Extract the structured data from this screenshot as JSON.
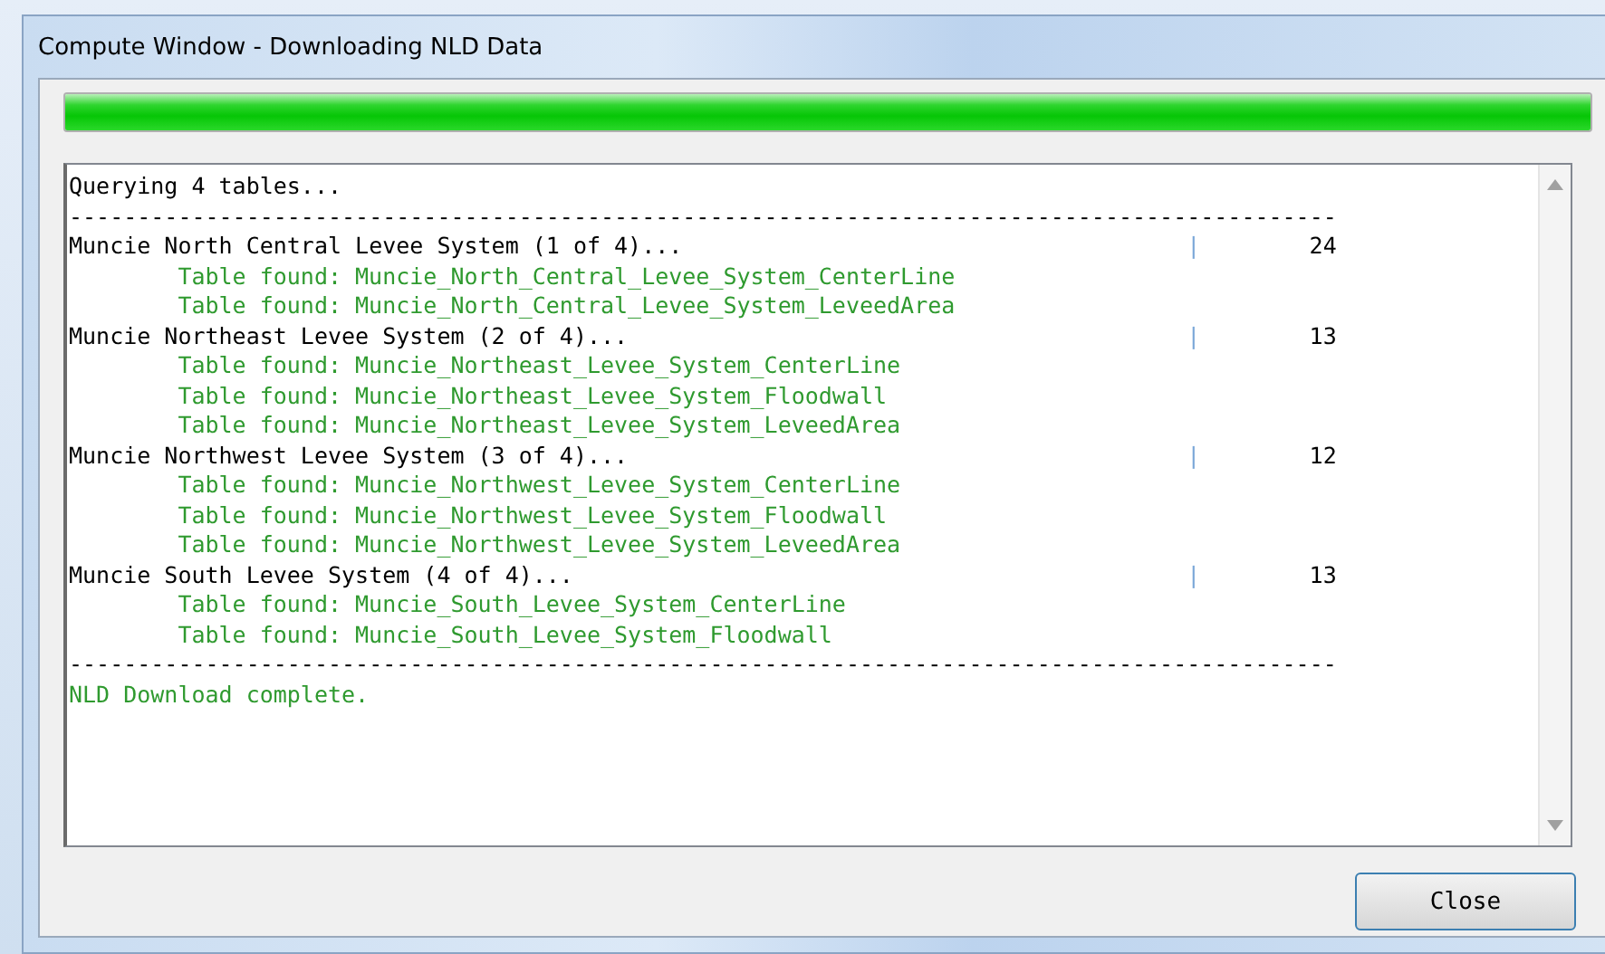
{
  "window": {
    "title": "Compute Window - Downloading NLD Data"
  },
  "progress": {
    "level": 1
  },
  "log": [
    {
      "kind": "text",
      "text": "Querying 4 tables..."
    },
    {
      "kind": "rule",
      "text": "---------------------------------------------------------------------------------------------"
    },
    {
      "kind": "system",
      "text": "Muncie North Central Levee System (1 of 4)...",
      "bar": "|",
      "count": "24"
    },
    {
      "kind": "found",
      "text": "Table found: Muncie_North_Central_Levee_System_CenterLine"
    },
    {
      "kind": "found",
      "text": "Table found: Muncie_North_Central_Levee_System_LeveedArea"
    },
    {
      "kind": "system",
      "text": "Muncie Northeast Levee System (2 of 4)...",
      "bar": "|",
      "count": "13"
    },
    {
      "kind": "found",
      "text": "Table found: Muncie_Northeast_Levee_System_CenterLine"
    },
    {
      "kind": "found",
      "text": "Table found: Muncie_Northeast_Levee_System_Floodwall"
    },
    {
      "kind": "found",
      "text": "Table found: Muncie_Northeast_Levee_System_LeveedArea"
    },
    {
      "kind": "system",
      "text": "Muncie Northwest Levee System (3 of 4)...",
      "bar": "|",
      "count": "12"
    },
    {
      "kind": "found",
      "text": "Table found: Muncie_Northwest_Levee_System_CenterLine"
    },
    {
      "kind": "found",
      "text": "Table found: Muncie_Northwest_Levee_System_Floodwall"
    },
    {
      "kind": "found",
      "text": "Table found: Muncie_Northwest_Levee_System_LeveedArea"
    },
    {
      "kind": "system",
      "text": "Muncie South Levee System (4 of 4)...",
      "bar": "|",
      "count": "13"
    },
    {
      "kind": "found",
      "text": "Table found: Muncie_South_Levee_System_CenterLine"
    },
    {
      "kind": "found",
      "text": "Table found: Muncie_South_Levee_System_Floodwall"
    },
    {
      "kind": "rule",
      "text": "---------------------------------------------------------------------------------------------"
    },
    {
      "kind": "done",
      "text": "NLD Download complete."
    }
  ],
  "buttons": [
    {
      "label": "Close"
    }
  ]
}
